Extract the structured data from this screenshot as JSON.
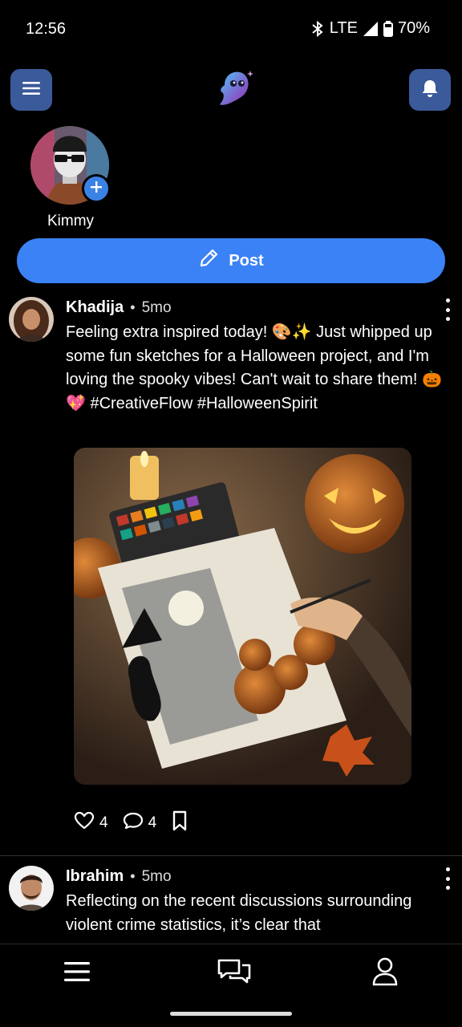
{
  "status_bar": {
    "time": "12:56",
    "network": "LTE",
    "battery": "70%",
    "icons": [
      "bluetooth-icon",
      "signal-icon",
      "battery-icon"
    ]
  },
  "top_bar": {
    "menu_icon": "menu-icon",
    "logo": "ghost-logo",
    "notifications_icon": "bell-icon"
  },
  "story": {
    "name": "Kimmy",
    "add_icon": "plus-icon"
  },
  "post_button": {
    "label": "Post",
    "icon": "pencil-icon"
  },
  "posts": [
    {
      "author": "Khadija",
      "separator": "•",
      "time": "5mo",
      "text": "Feeling extra inspired today! 🎨✨ Just whipped up some fun sketches for a Halloween project, and I'm loving the spooky vibes! Can't wait to share them! 🎃💖 #CreativeFlow #HalloweenSpirit",
      "likes": "4",
      "comments": "4",
      "has_image": true
    },
    {
      "author": "Ibrahim",
      "separator": "•",
      "time": "5mo",
      "text": "Reflecting on the recent discussions surrounding violent crime statistics, it’s clear that"
    }
  ],
  "bottom_nav": {
    "items": [
      "feed-icon",
      "chat-icon",
      "profile-icon"
    ]
  },
  "colors": {
    "accent": "#3b82f6",
    "square_button": "#3b5a9a",
    "background": "#000000"
  }
}
